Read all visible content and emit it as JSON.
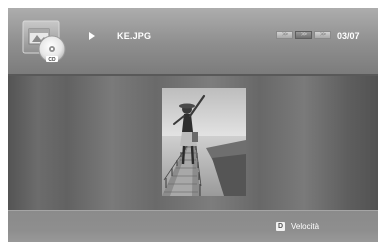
{
  "header": {
    "source_icon": "cd-disc-icon",
    "disc_label": "CD",
    "play_icon": "play-icon",
    "filename": "KE.JPG",
    "page_count": "03/07",
    "speed_segments": [
      {
        "label": ">>",
        "active": false
      },
      {
        "label": ">>",
        "active": true
      },
      {
        "label": ">>",
        "active": false
      }
    ]
  },
  "viewer": {
    "photo_icon": "beach-pier-photo"
  },
  "footer": {
    "key_label": "D",
    "key_icon": "d-key-icon",
    "action_label": "Velocità"
  },
  "colors": {
    "panel": "#6b6b6b",
    "header": "#9a9a9a",
    "text": "#ffffff"
  }
}
